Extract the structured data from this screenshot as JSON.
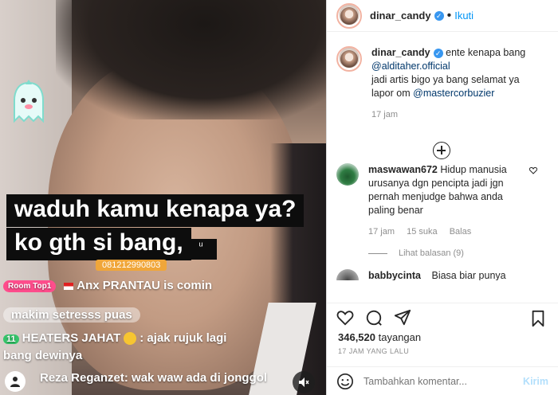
{
  "media": {
    "caption_line1": "waduh kamu kenapa ya?",
    "caption_line2": "ko gth si bang,",
    "caption_tag": "ᵘ",
    "number_tag": "081212990803",
    "chat": [
      {
        "badge": "Room Top1",
        "user": "Anx PRANTAU",
        "text": "is comin"
      },
      {
        "user": "",
        "text": "makim setresss puas"
      },
      {
        "level": "11",
        "user": "HEATERS JAHAT",
        "text": ": ajak rujuk lagi"
      },
      {
        "user": "",
        "text": "bang dewinya"
      },
      {
        "level": "",
        "user": "Reza Reganzet",
        "text": ": wak waw ada di jonggol"
      }
    ]
  },
  "post": {
    "username": "dinar_candy",
    "follow_label": "Ikuti",
    "dot": "•",
    "caption": {
      "user": "dinar_candy",
      "text_before": "ente kenapa bang",
      "mention1": "@alditaher.official",
      "line2": "jadi artis bigo ya bang selamat ya",
      "line3_prefix": "lapor om",
      "mention2": "@mastercorbuzier",
      "time": "17 jam"
    },
    "comments": [
      {
        "user": "maswawan672",
        "text": "Hidup manusia urusanya dgn pencipta jadi jgn pernah menjudge bahwa anda paling benar",
        "time": "17 jam",
        "likes": "15 suka",
        "reply_label": "Balas",
        "view_replies": "Lihat balasan (9)"
      },
      {
        "user": "babbycinta",
        "text": "Biasa biar punya"
      }
    ],
    "views_count": "346,520",
    "views_label": "tayangan",
    "time_ago": "17 JAM YANG LALU",
    "comment_placeholder": "Tambahkan komentar...",
    "send_label": "Kirim"
  }
}
